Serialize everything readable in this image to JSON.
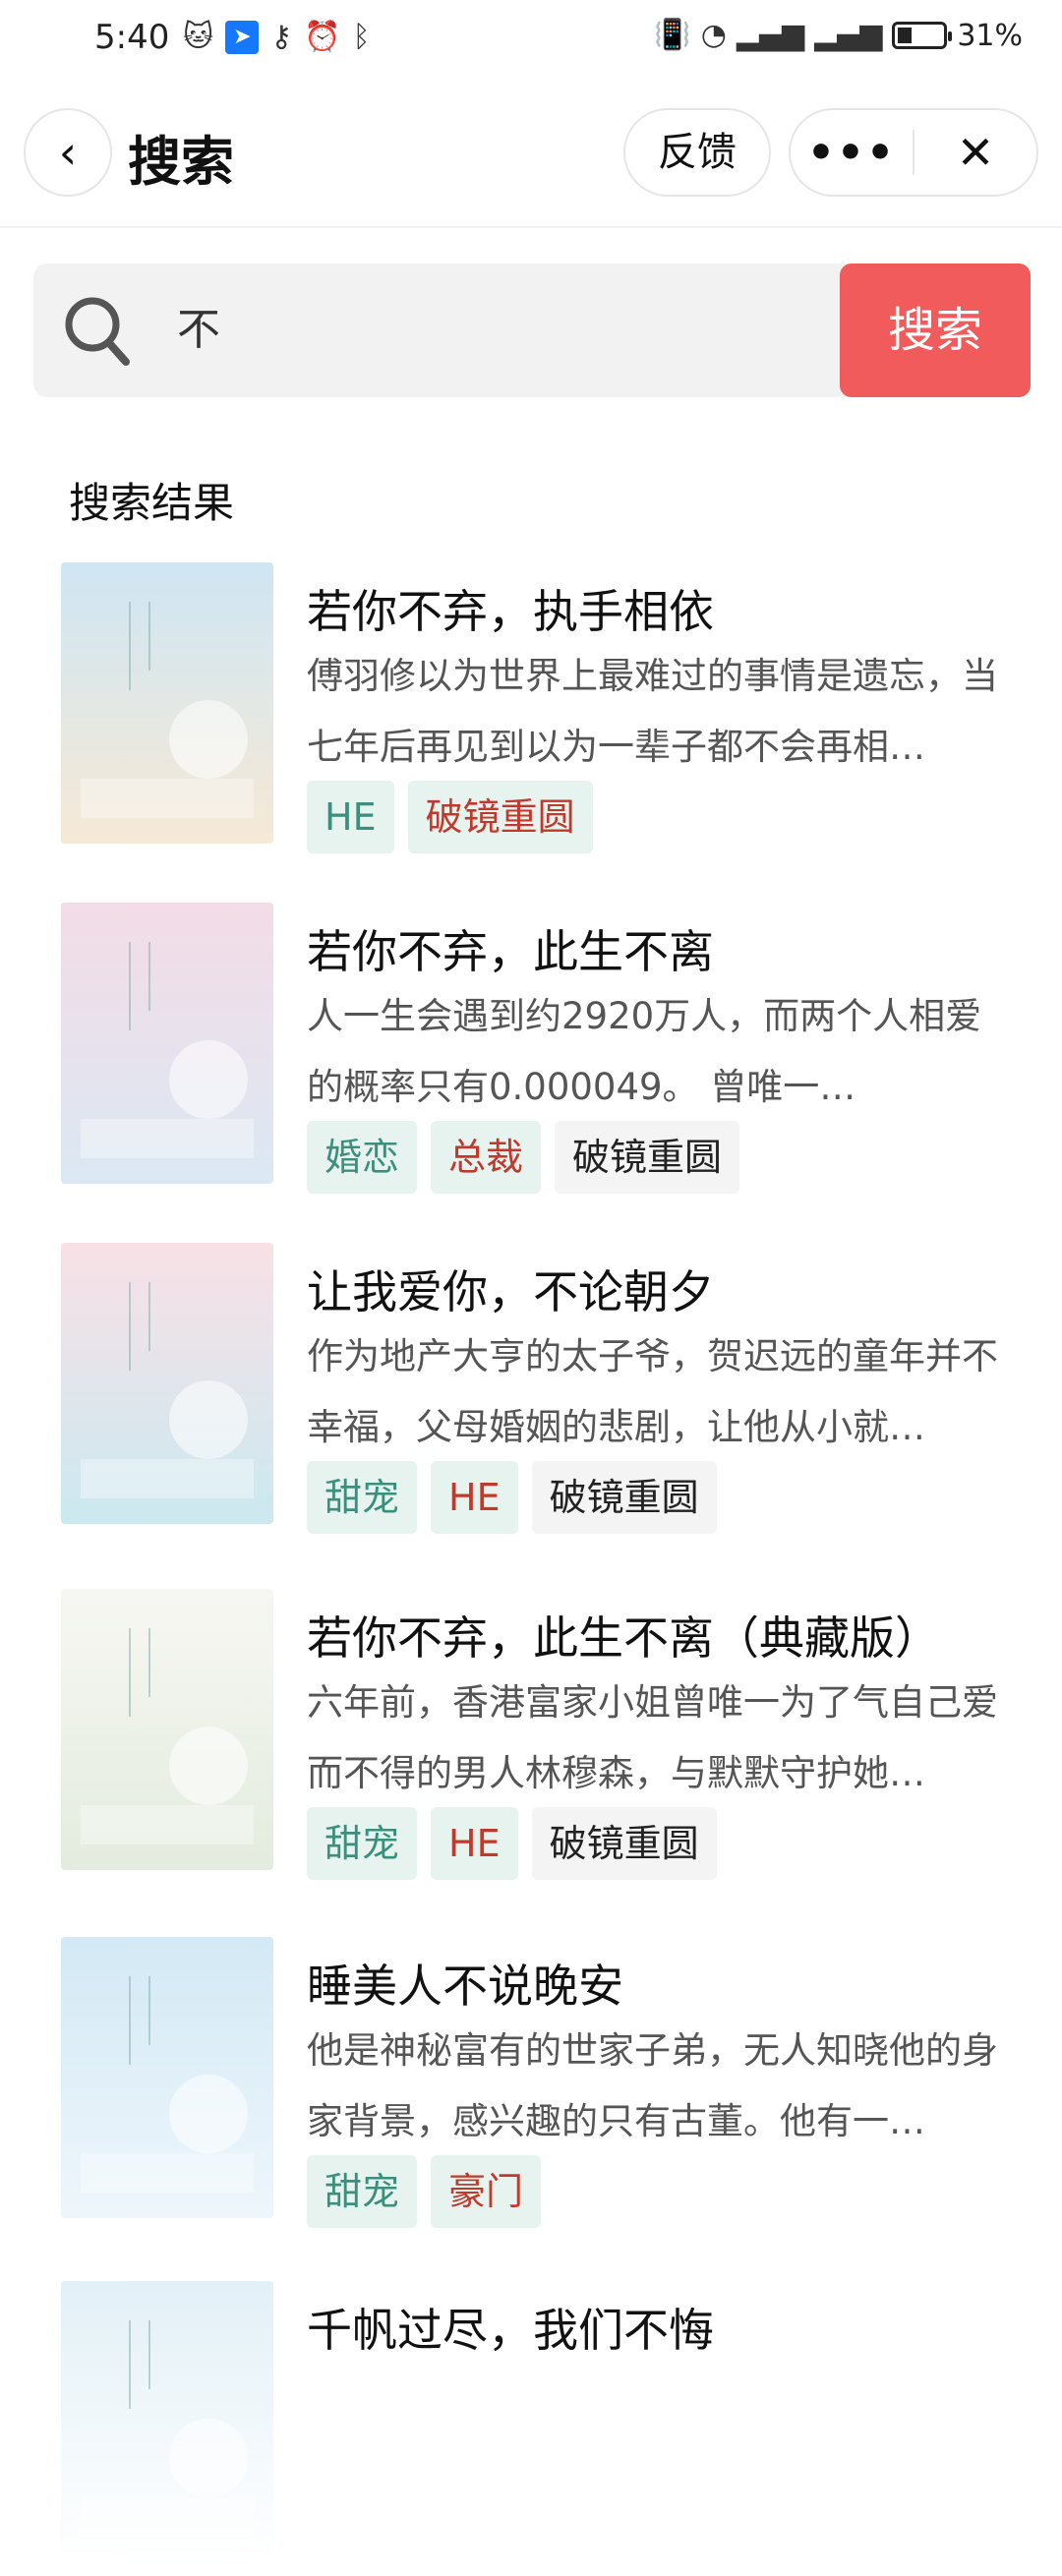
{
  "status_bar": {
    "time": "5:40",
    "battery": "31%",
    "battery_level": 0.31
  },
  "header": {
    "title": "搜索",
    "feedback_label": "反馈",
    "more_label": "•••",
    "close_label": "✕",
    "back_label": "‹"
  },
  "search": {
    "query": "不",
    "button_label": "搜索"
  },
  "section_title": "搜索结果",
  "results": [
    {
      "title": "若你不弃，执手相依",
      "desc": "傅羽修以为世界上最难过的事情是遗忘，当七年后再见到以为一辈子都不会再相…",
      "tags": [
        {
          "label": "HE",
          "style": "green"
        },
        {
          "label": "破镜重圆",
          "style": "red"
        }
      ],
      "cover_colors": [
        "#cfe6f3",
        "#f6e9d6"
      ]
    },
    {
      "title": "若你不弃，此生不离",
      "desc": "人一生会遇到约2920万人，而两个人相爱的概率只有0.000049。        曾唯一…",
      "tags": [
        {
          "label": "婚恋",
          "style": "green"
        },
        {
          "label": "总裁",
          "style": "red"
        },
        {
          "label": "破镜重圆",
          "style": "gray"
        }
      ],
      "cover_colors": [
        "#f3dce6",
        "#dbe8f3"
      ]
    },
    {
      "title": "让我爱你，不论朝夕",
      "desc": "作为地产大亨的太子爷，贺迟远的童年并不幸福，父母婚姻的悲剧，让他从小就…",
      "tags": [
        {
          "label": "甜宠",
          "style": "green"
        },
        {
          "label": "HE",
          "style": "red"
        },
        {
          "label": "破镜重圆",
          "style": "gray"
        }
      ],
      "cover_colors": [
        "#f8e1e6",
        "#cbe9f0"
      ]
    },
    {
      "title": "若你不弃，此生不离（典藏版）",
      "desc": "六年前，香港富家小姐曾唯一为了气自己爱而不得的男人林穆森，与默默守护她…",
      "tags": [
        {
          "label": "甜宠",
          "style": "green"
        },
        {
          "label": "HE",
          "style": "red"
        },
        {
          "label": "破镜重圆",
          "style": "gray"
        }
      ],
      "cover_colors": [
        "#f7f7f2",
        "#e3ecdf"
      ]
    },
    {
      "title": "睡美人不说晚安",
      "desc": "他是神秘富有的世家子弟，无人知晓他的身家背景，感兴趣的只有古董。他有一…",
      "tags": [
        {
          "label": "甜宠",
          "style": "green"
        },
        {
          "label": "豪门",
          "style": "red"
        }
      ],
      "cover_colors": [
        "#d3e9f5",
        "#eef6fb"
      ]
    },
    {
      "title": "千帆过尽，我们不悔",
      "desc": "",
      "tags": [],
      "cover_colors": [
        "#e2f0f7",
        "#ffffff"
      ]
    }
  ]
}
